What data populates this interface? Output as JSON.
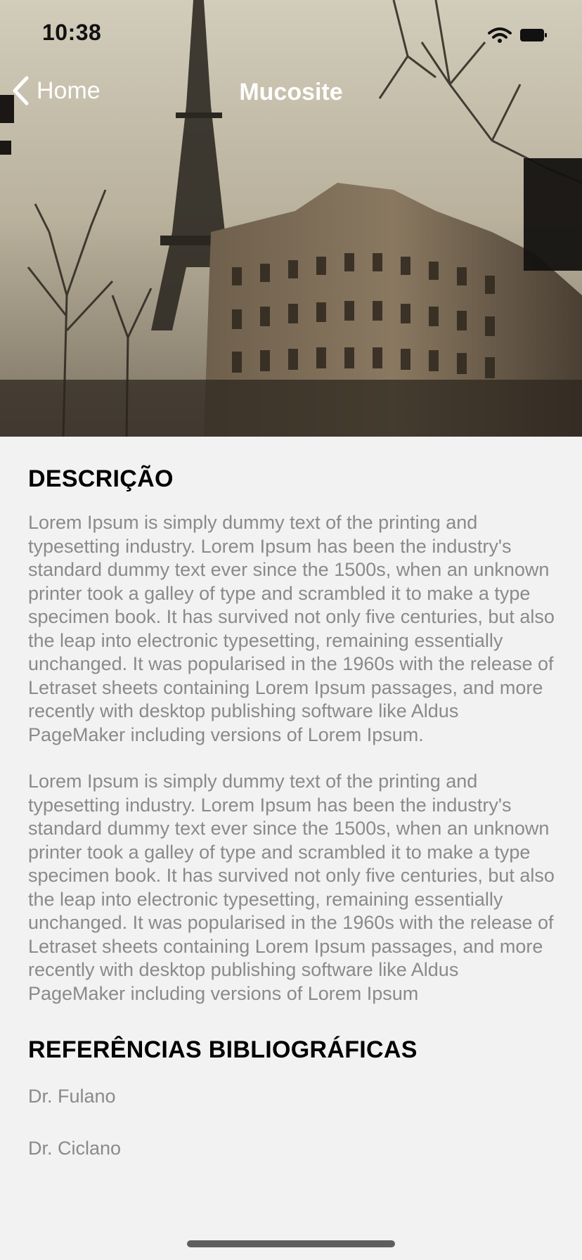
{
  "status_bar": {
    "time": "10:38"
  },
  "nav": {
    "back_label": "Home",
    "title": "Mucosite"
  },
  "description": {
    "title": "DESCRIÇÃO",
    "paragraphs": [
      "Lorem Ipsum is simply dummy text of the printing and typesetting industry. Lorem Ipsum has been the industry's standard dummy text ever since the 1500s, when an unknown printer took a galley of type and scrambled it to make a type specimen book. It has survived not only five centuries, but also the leap into electronic typesetting, remaining essentially unchanged. It was popularised in the 1960s with the release of Letraset sheets containing Lorem Ipsum passages, and more recently with desktop publishing software like Aldus PageMaker including versions of Lorem Ipsum.",
      "Lorem Ipsum is simply dummy text of the printing and typesetting industry. Lorem Ipsum has been the industry's standard dummy text ever since the 1500s, when an unknown printer took a galley of type and scrambled it to make a type specimen book. It has survived not only five centuries, but also the leap into electronic typesetting, remaining essentially unchanged. It was popularised in the 1960s with the release of Letraset sheets containing Lorem Ipsum passages, and more recently with desktop publishing software like Aldus PageMaker including versions of Lorem Ipsum"
    ]
  },
  "references": {
    "title": "REFERÊNCIAS BIBLIOGRÁFICAS",
    "items": [
      "Dr. Fulano",
      "Dr. Ciclano"
    ]
  },
  "icons": {
    "back": "chevron-left-icon",
    "wifi": "wifi-icon",
    "battery": "battery-icon"
  },
  "colors": {
    "background": "#f2f2f2",
    "body_text": "#8a8a8a",
    "heading_text": "#000000",
    "nav_text": "#ffffff"
  }
}
